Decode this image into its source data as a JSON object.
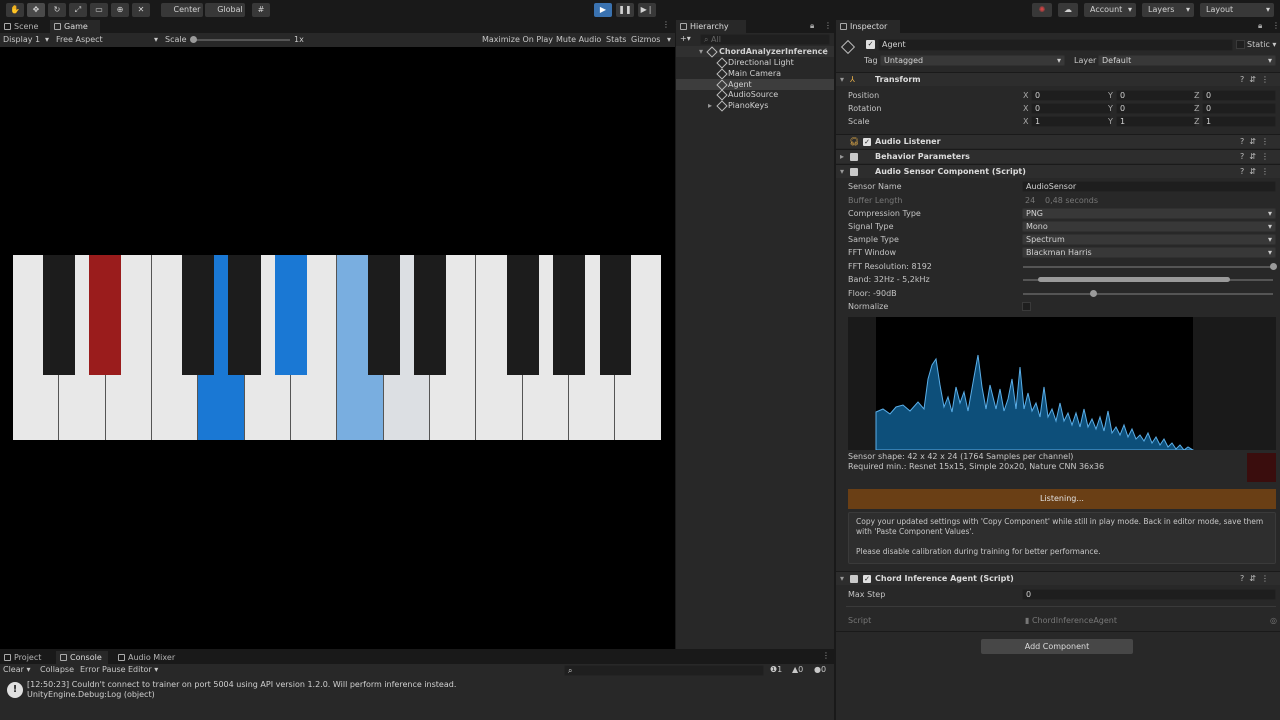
{
  "toolbar": {
    "center_label": "Center",
    "global_label": "Global",
    "account_label": "Account",
    "layers_label": "Layers",
    "layout_label": "Layout"
  },
  "scene_view": {
    "tabs": [
      "Scene",
      "Game"
    ],
    "display": "Display 1",
    "aspect": "Free Aspect",
    "scale_label": "Scale",
    "scale_value": "1x",
    "maximize_label": "Maximize On Play",
    "mute_label": "Mute Audio",
    "stats_label": "Stats",
    "gizmos_label": "Gizmos"
  },
  "hierarchy": {
    "tab_label": "Hierarchy",
    "search_placeholder": "All",
    "root": "ChordAnalyzerInference",
    "items": [
      "Directional Light",
      "Main Camera",
      "Agent",
      "AudioSource",
      "PianoKeys"
    ]
  },
  "inspector": {
    "tab_label": "Inspector",
    "object_name": "Agent",
    "static_label": "Static",
    "tag_label": "Tag",
    "tag_value": "Untagged",
    "layer_label": "Layer",
    "layer_value": "Default",
    "transform": {
      "title": "Transform",
      "position_label": "Position",
      "rotation_label": "Rotation",
      "scale_label": "Scale",
      "position": [
        "0",
        "0",
        "0"
      ],
      "rotation": [
        "0",
        "0",
        "0"
      ],
      "scale": [
        "1",
        "1",
        "1"
      ],
      "axis": [
        "X",
        "Y",
        "Z"
      ]
    },
    "audio_listener": "Audio Listener",
    "behavior_params": "Behavior Parameters",
    "sensor": {
      "title": "Audio Sensor Component (Script)",
      "sensor_name_label": "Sensor Name",
      "sensor_name_value": "AudioSensor",
      "buffer_length_label": "Buffer Length",
      "buffer_length_value": "24",
      "buffer_seconds": "0,48 seconds",
      "compression_label": "Compression Type",
      "compression_value": "PNG",
      "signal_label": "Signal Type",
      "signal_value": "Mono",
      "sample_label": "Sample Type",
      "sample_value": "Spectrum",
      "fft_window_label": "FFT Window",
      "fft_window_value": "Blackman Harris",
      "fft_res_label": "FFT Resolution: 8192",
      "band_label": "Band: 32Hz - 5,2kHz",
      "floor_label": "Floor: -90dB",
      "normalize_label": "Normalize",
      "shape_text": "Sensor shape: 42 x 42 x 24 (1764 Samples per channel)",
      "required_text": "Required min.: Resnet 15x15, Simple 20x20, Nature CNN 36x36",
      "listening": "Listening...",
      "info_1": "Copy your updated settings with 'Copy Component' while still in play mode. Back in editor mode, save them with 'Paste Component Values'.",
      "info_2": "Please disable calibration during training for better performance."
    },
    "agent": {
      "title": "Chord Inference Agent (Script)",
      "max_step_label": "Max Step",
      "max_step_value": "0",
      "script_label": "Script",
      "script_value": "ChordInferenceAgent"
    },
    "add_component": "Add Component"
  },
  "console": {
    "tabs": [
      "Project",
      "Console",
      "Audio Mixer"
    ],
    "clear": "Clear",
    "collapse": "Collapse",
    "error_pause": "Error Pause",
    "editor": "Editor",
    "count_warn": "1",
    "count_a": "0",
    "count_b": "0",
    "message_1": "[12:50:23] Couldn't connect to trainer on port 5004 using API version 1.2.0. Will perform inference instead.",
    "message_2": "UnityEngine.Debug:Log (object)"
  },
  "colors": {
    "key_red": "#9a1c1c",
    "key_blue": "#1a78d4",
    "key_light_blue": "#79aee0",
    "listening_bar": "#6a3f15"
  },
  "piano": {
    "white_key_count": 14,
    "black_key_count": 10
  }
}
